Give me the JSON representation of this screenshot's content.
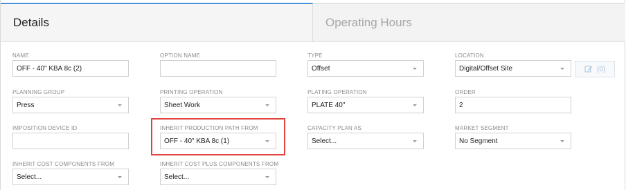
{
  "tabs": [
    {
      "label": "Details"
    },
    {
      "label": "Operating Hours"
    }
  ],
  "fields": {
    "name": {
      "label": "NAME",
      "value": "OFF - 40\" KBA 8c (2)"
    },
    "option_name": {
      "label": "OPTION NAME",
      "value": ""
    },
    "type": {
      "label": "TYPE",
      "value": "Offset"
    },
    "location": {
      "label": "LOCATION",
      "value": "Digital/Offset Site"
    },
    "location_edit": {
      "count": "(0)",
      "icon": "edit-icon"
    },
    "planning_group": {
      "label": "PLANNING GROUP",
      "value": "Press"
    },
    "printing_operation": {
      "label": "PRINTING OPERATION",
      "value": "Sheet Work"
    },
    "plating_operation": {
      "label": "PLATING OPERATION",
      "value": "PLATE 40\""
    },
    "order": {
      "label": "ORDER",
      "value": "2"
    },
    "imposition_device_id": {
      "label": "IMPOSITION DEVICE ID",
      "value": ""
    },
    "inherit_production_path": {
      "label": "INHERIT PRODUCTION PATH FROM",
      "value": "OFF - 40\" KBA 8c (1)"
    },
    "capacity_plan_as": {
      "label": "CAPACITY PLAN AS",
      "value": "Select..."
    },
    "market_segment": {
      "label": "MARKET SEGMENT",
      "value": "No Segment"
    },
    "inherit_cost_components": {
      "label": "INHERIT COST COMPONENTS FROM",
      "value": "Select..."
    },
    "inherit_cost_plus_components": {
      "label": "INHERIT COST PLUS COMPONENTS FROM",
      "value": "Select..."
    }
  },
  "colors": {
    "accent": "#4a90d9",
    "highlight": "#e0443e"
  }
}
